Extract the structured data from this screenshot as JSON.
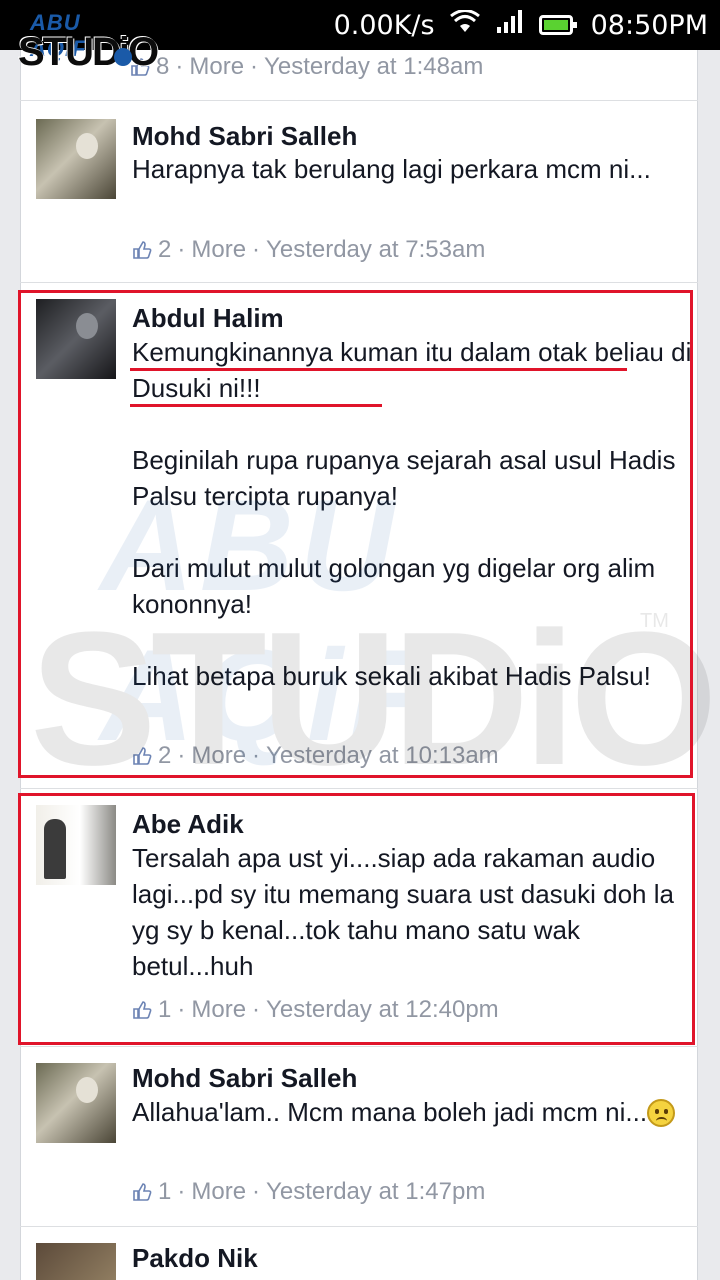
{
  "status_bar": {
    "net_speed": "0.00K/s",
    "time": "08:50PM",
    "icons": [
      "wifi-icon",
      "signal-icon",
      "battery-icon"
    ]
  },
  "logo": {
    "line1": "ABU AQiF",
    "line2": "STUDiO"
  },
  "watermark": {
    "line1": "ABU AQiF",
    "line2": "STUDiO",
    "tm": "TM"
  },
  "top_meta": {
    "likes": "8",
    "more": "More",
    "time": "Yesterday at 1:48am"
  },
  "comments": [
    {
      "name": "Mohd Sabri Salleh",
      "text": "Harapnya tak berulang lagi perkara mcm ni...",
      "likes": "2",
      "more": "More",
      "time": "Yesterday at 7:53am"
    },
    {
      "name": "Abdul Halim",
      "text_1": "Kemungkinannya kuman itu dalam otak beliau di Dusuki ni!!!",
      "text_2": "Beginilah rupa rupanya sejarah asal usul Hadis Palsu tercipta rupanya!",
      "text_3": "Dari mulut mulut golongan yg digelar org alim kononnya!",
      "text_4": "Lihat betapa buruk sekali akibat Hadis Palsu!",
      "likes": "2",
      "more": "More",
      "time": "Yesterday at 10:13am"
    },
    {
      "name": "Abe Adik",
      "text": "Tersalah apa ust yi....siap ada rakaman audio lagi...pd sy itu memang suara ust dasuki doh la yg sy b kenal...tok tahu mano satu wak betul...huh",
      "likes": "1",
      "more": "More",
      "time": "Yesterday at 12:40pm"
    },
    {
      "name": "Mohd Sabri Salleh",
      "text": "Allahua'lam.. Mcm mana boleh jadi mcm ni...",
      "likes": "1",
      "more": "More",
      "time": "Yesterday at 1:47pm"
    },
    {
      "name": "Pakdo Nik"
    }
  ],
  "colors": {
    "highlight": "#e0142a",
    "meta": "#9197a3",
    "text": "#141823"
  }
}
